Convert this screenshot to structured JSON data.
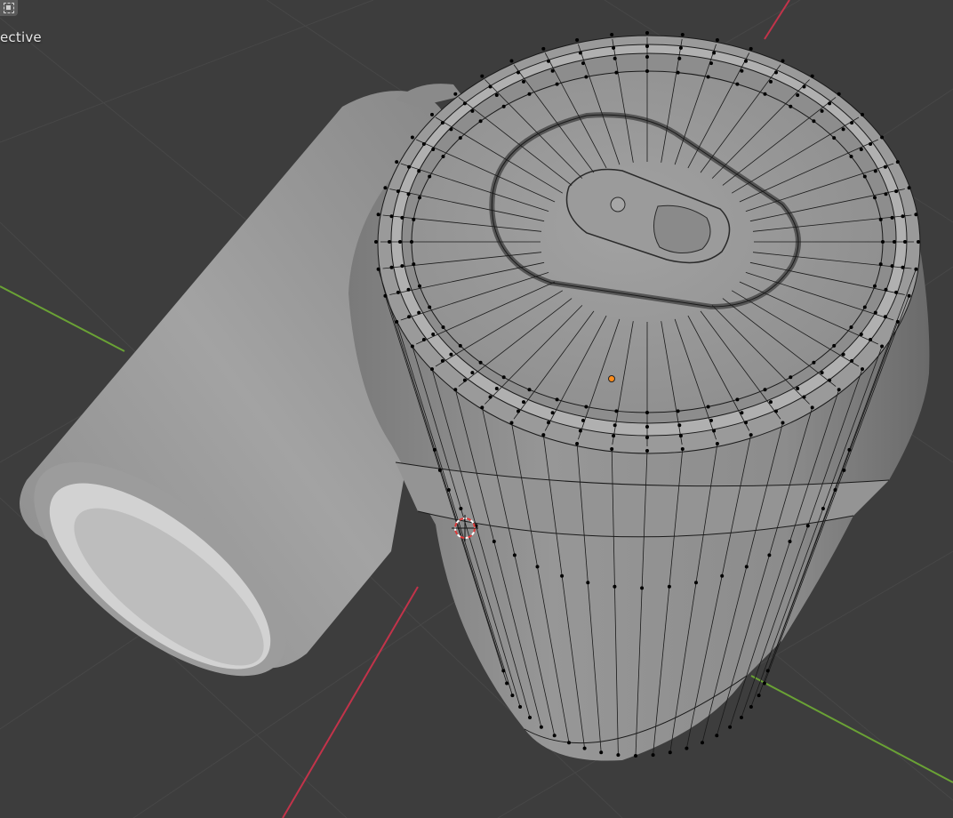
{
  "viewport": {
    "view_label": "ective",
    "colors": {
      "background": "#3d3d3d",
      "grid": "#484848",
      "x_axis": "#c2334a",
      "y_axis": "#6aa235",
      "mesh_fill": "#8a8a8a",
      "mesh_wire": "#1a1a1a",
      "vertex": "#000000",
      "origin": "#ff8c1a",
      "cursor_red": "#e03a3a"
    },
    "icons": {
      "select_mode": "box-select-icon",
      "cursor": "3d-cursor-icon",
      "origin": "object-origin-dot"
    },
    "objects": [
      "background-can",
      "edit-mode-can"
    ]
  }
}
